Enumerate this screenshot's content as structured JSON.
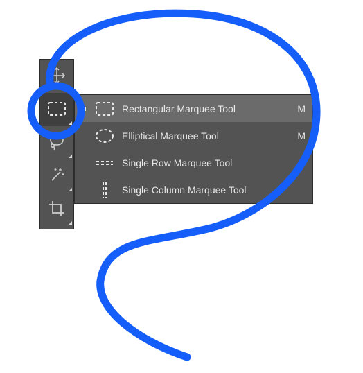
{
  "toolbar": {
    "items": [
      {
        "id": "move-tool",
        "icon": "move"
      },
      {
        "id": "marquee-tool",
        "icon": "rect-marquee",
        "selected": true
      },
      {
        "id": "lasso-tool",
        "icon": "lasso"
      },
      {
        "id": "magic-wand-tool",
        "icon": "wand"
      },
      {
        "id": "crop-tool",
        "icon": "crop"
      }
    ]
  },
  "flyout": {
    "items": [
      {
        "id": "rect-marquee",
        "label": "Rectangular Marquee Tool",
        "shortcut": "M",
        "icon": "rect-marquee",
        "selected": true
      },
      {
        "id": "ellipse-marquee",
        "label": "Elliptical Marquee Tool",
        "shortcut": "M",
        "icon": "ellipse-marquee"
      },
      {
        "id": "row-marquee",
        "label": "Single Row Marquee Tool",
        "shortcut": "",
        "icon": "row-marquee"
      },
      {
        "id": "col-marquee",
        "label": "Single Column Marquee Tool",
        "shortcut": "",
        "icon": "col-marquee"
      }
    ]
  },
  "annotation": {
    "stroke_color": "#155EF9",
    "stroke_width": 10
  }
}
